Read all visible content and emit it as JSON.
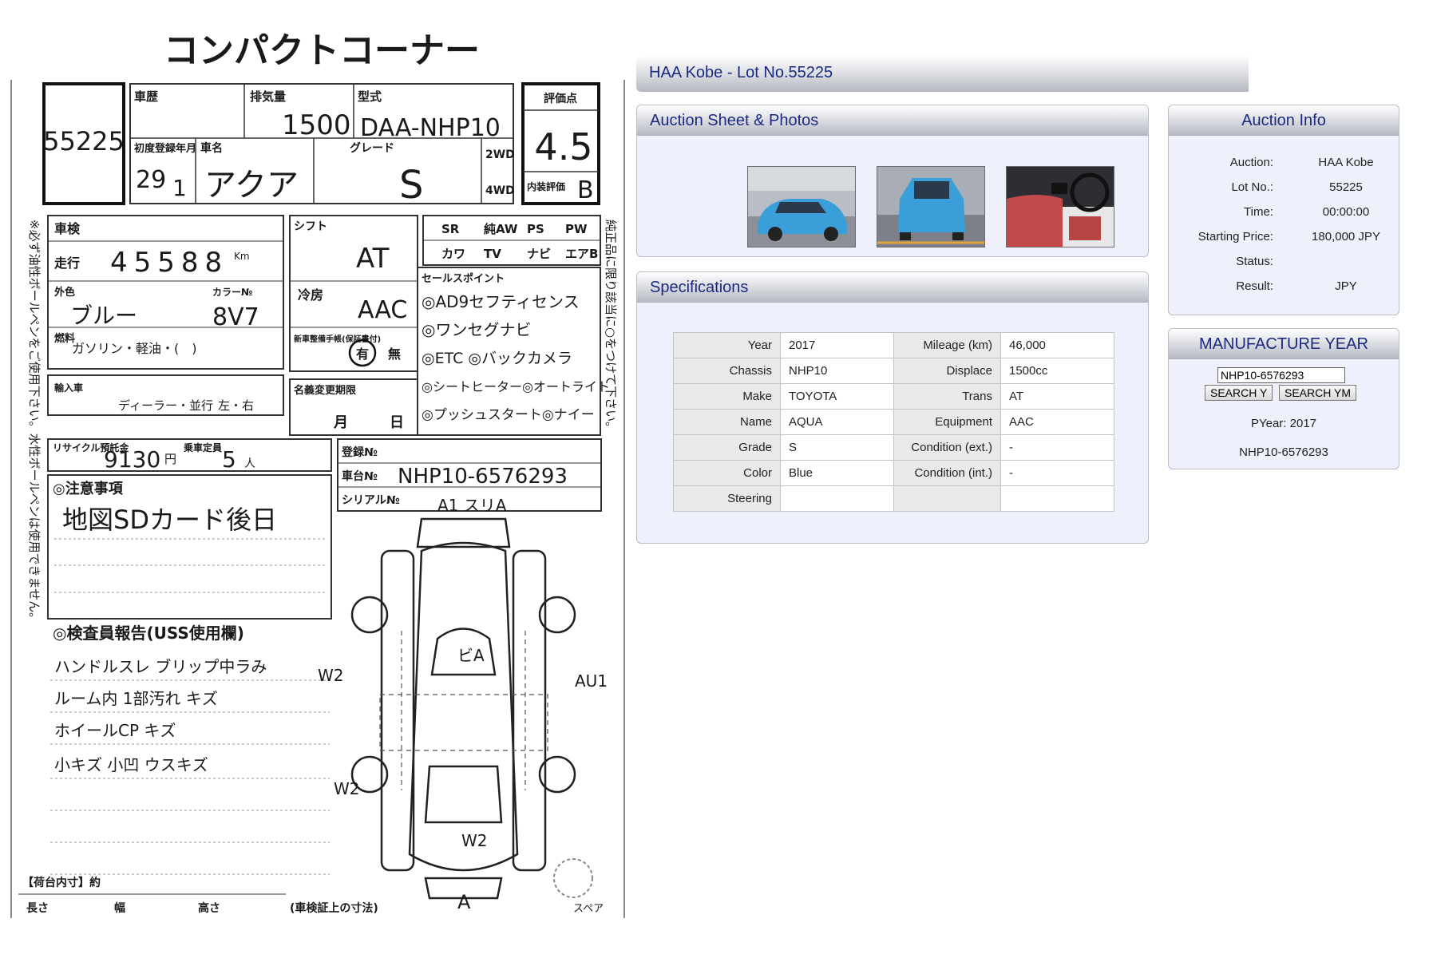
{
  "sheet": {
    "header": "コンパクトコーナー",
    "lot_number": "55225",
    "history_label": "車歴",
    "displacement_label": "排気量",
    "displacement": "1500",
    "model_label": "型式",
    "model_code": "DAA-NHP10",
    "grade_score_label": "評価点",
    "grade_score": "4.5",
    "first_reg_label": "初度登録年月",
    "first_reg_year": "29",
    "first_reg_month": "1",
    "car_name_label": "車名",
    "car_name": "アクア",
    "grade_label": "グレード",
    "grade": "S",
    "drive_2wd": "2WD",
    "drive_4wd": "4WD",
    "interior_label": "内装評価",
    "interior_score": "B",
    "inspection_label": "車検",
    "mileage_label": "走行",
    "mileage": "45588",
    "mileage_unit": "Km",
    "color_label": "外色",
    "color": "ブルー",
    "color_code_label": "カラー№",
    "color_code": "8V7",
    "fuel_label": "燃料",
    "fuel": "ガソリン・軽油・(　)",
    "shift_label": "シフト",
    "shift": "AT",
    "ac_label": "冷房",
    "ac": "AAC",
    "manual_label": "新車整備手帳(保証書付)",
    "manual_yes": "有",
    "manual_no": "無",
    "equip_headers": [
      "SR",
      "純AW",
      "PS",
      "PW"
    ],
    "equip_headers2": [
      "カワ",
      "TV",
      "ナビ",
      "エアB"
    ],
    "sales_points_label": "セールスポイント",
    "sales_points": [
      "◎AD9セフティセンス",
      "◎ワンセグナビ",
      "◎ETC ◎バックカメラ",
      "◎シートヒーター◎オートライト",
      "◎プッシュスタート◎ナイー"
    ],
    "import_label": "輸入車",
    "dealer": "ディーラー・並行",
    "handle": "左・右",
    "name_change_label": "名義変更期限",
    "month_label": "月",
    "day_label": "日",
    "recycle_label": "リサイクル預託金",
    "recycle_fee": "9130",
    "yen": "円",
    "capacity_label": "乗車定員",
    "capacity": "5",
    "person": "人",
    "reg_no_label": "登録№",
    "chassis_no_label": "車台№",
    "chassis_no": "NHP10-6576293",
    "serial_label": "シリアル№",
    "notes_label": "◎注意事項",
    "notes": "地図SDカード後日",
    "inspector_label": "◎検査員報告(USS使用欄)",
    "inspector_notes": [
      "ハンドルスレ ブリップ中ラみ",
      "ルーム内 1部汚れ キズ",
      "ホイールCP キズ",
      "小キズ 小凹 ウスキズ"
    ],
    "cargo_label": "【荷台内寸】約",
    "cargo_len": "長さ",
    "cargo_width": "幅",
    "cargo_height": "高さ",
    "cargo_note": "(車検証上の寸法)",
    "diagram_marks": [
      "A1 スリA",
      "ビA",
      "W2",
      "W2",
      "AU1",
      "W2",
      "A",
      "スペア"
    ],
    "side_note_left": "※必ず油性ボールペンをご使用下さい。水性ボールペンは使用できません。",
    "side_note_right": "純正品に限り該当に○をつけて下さい。"
  },
  "title": "HAA Kobe - Lot No.55225",
  "photos_panel": {
    "title": "Auction Sheet & Photos",
    "thumbnails": [
      "car-front-photo",
      "car-rear-photo",
      "car-interior-photo"
    ]
  },
  "specs_panel": {
    "title": "Specifications",
    "rows": [
      {
        "k1": "Year",
        "v1": "2017",
        "k2": "Mileage (km)",
        "v2": "46,000"
      },
      {
        "k1": "Chassis",
        "v1": "NHP10",
        "k2": "Displace",
        "v2": "1500cc"
      },
      {
        "k1": "Make",
        "v1": "TOYOTA",
        "k2": "Trans",
        "v2": "AT"
      },
      {
        "k1": "Name",
        "v1": "AQUA",
        "k2": "Equipment",
        "v2": "AAC"
      },
      {
        "k1": "Grade",
        "v1": "S",
        "k2": "Condition (ext.)",
        "v2": "-"
      },
      {
        "k1": "Color",
        "v1": "Blue",
        "k2": "Condition (int.)",
        "v2": "-"
      },
      {
        "k1": "Steering",
        "v1": "",
        "k2": "",
        "v2": ""
      }
    ]
  },
  "auction_info": {
    "title": "Auction Info",
    "rows": [
      {
        "k": "Auction:",
        "v": "HAA Kobe"
      },
      {
        "k": "Lot No.:",
        "v": "55225"
      },
      {
        "k": "Time:",
        "v": "00:00:00"
      },
      {
        "k": "Starting Price:",
        "v": "180,000 JPY"
      },
      {
        "k": "Status:",
        "v": ""
      },
      {
        "k": "Result:",
        "v": "JPY"
      }
    ]
  },
  "manufacture_year": {
    "title": "MANUFACTURE YEAR",
    "input_value": "NHP10-6576293",
    "search_y": "SEARCH Y",
    "search_ym": "SEARCH YM",
    "pyear": "PYear: 2017",
    "chassis": "NHP10-6576293"
  },
  "colors": {
    "header_text": "#1a2a80",
    "panel_bg": "#eef1fb",
    "car_blue": "#3a9fd8"
  }
}
